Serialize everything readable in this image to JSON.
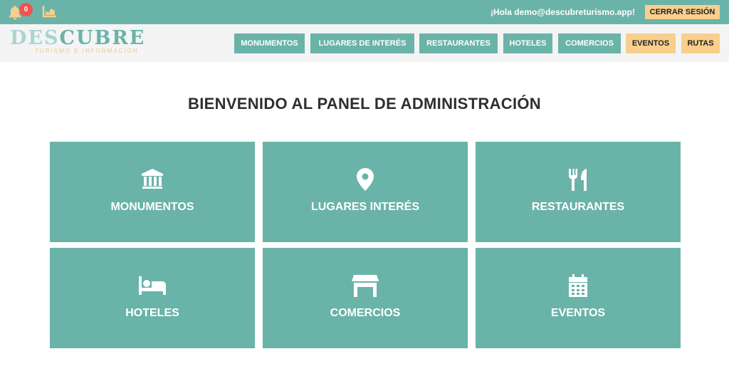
{
  "topbar": {
    "notification_count": "0",
    "greeting": "¡Hola demo@descubreturismo.app!",
    "logout_label": "CERRAR SESIÓN",
    "icons": [
      "bell-icon",
      "chart-icon"
    ]
  },
  "logo": {
    "main_part1": "DES",
    "main_part2": "CUBRE",
    "subtitle": "TURISMO E INFORMACIÓN"
  },
  "nav": [
    {
      "label": "MONUMENTOS"
    },
    {
      "label": "LUGARES DE INTERÉS"
    },
    {
      "label": "RESTAURANTES"
    },
    {
      "label": "HOTELES"
    },
    {
      "label": "COMERCIOS"
    },
    {
      "label": "EVENTOS"
    },
    {
      "label": "RUTAS"
    }
  ],
  "main": {
    "title": "BIENVENIDO AL PANEL DE ADMINISTRACIÓN",
    "cards": [
      {
        "label": "MONUMENTOS",
        "icon": "landmark-icon"
      },
      {
        "label": "LUGARES INTERÉS",
        "icon": "map-pin-icon"
      },
      {
        "label": "RESTAURANTES",
        "icon": "utensils-icon"
      },
      {
        "label": "HOTELES",
        "icon": "bed-icon"
      },
      {
        "label": "COMERCIOS",
        "icon": "store-icon"
      },
      {
        "label": "EVENTOS",
        "icon": "calendar-icon"
      }
    ]
  },
  "colors": {
    "teal": "#6ab3a9",
    "accent": "#f8cf8c",
    "badge": "#ef5350",
    "header_bg": "#f4f4f4"
  }
}
